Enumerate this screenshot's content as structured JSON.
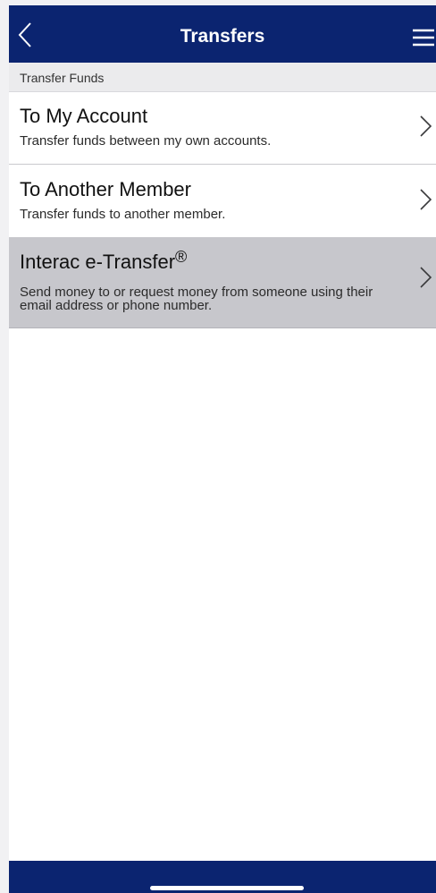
{
  "nav": {
    "title": "Transfers",
    "back_icon": "chevron-left-icon",
    "menu_icon": "hamburger-menu-icon"
  },
  "section": {
    "header": "Transfer Funds"
  },
  "items": [
    {
      "title": "To My Account",
      "subtitle": "Transfer funds between my own accounts."
    },
    {
      "title": "To Another Member",
      "subtitle": "Transfer funds to another member."
    },
    {
      "title": "Interac e-Transfer",
      "title_mark": "®",
      "subtitle": "Send money to or request money from someone using their email address or phone number.",
      "selected": true
    }
  ],
  "colors": {
    "nav_background": "#0b2470",
    "selected_row": "#c7c7cc",
    "section_header_background": "#ebebed"
  }
}
